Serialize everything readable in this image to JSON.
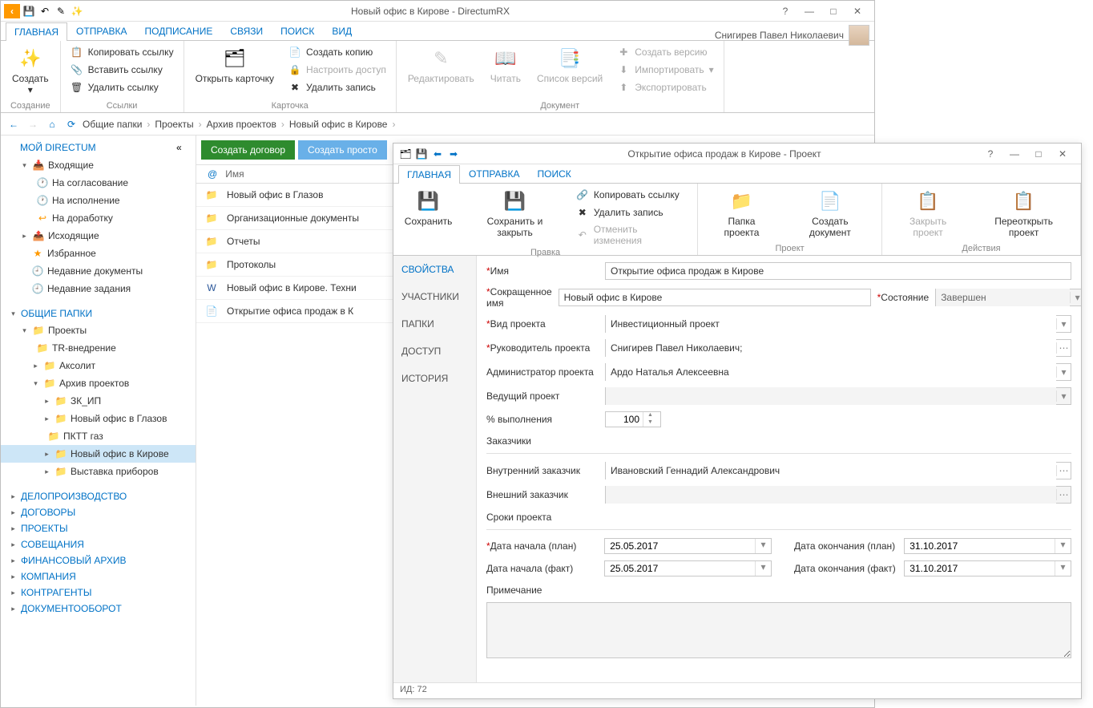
{
  "main": {
    "title": "Новый офис в Кирове - DirectumRX",
    "user": "Снигирев Павел Николаевич",
    "tabs": [
      "ГЛАВНАЯ",
      "ОТПРАВКА",
      "ПОДПИСАНИЕ",
      "СВЯЗИ",
      "ПОИСК",
      "ВИД"
    ],
    "ribbon": {
      "create_group": "Создание",
      "create": "Создать",
      "links_group": "Ссылки",
      "copy_link": "Копировать ссылку",
      "paste_link": "Вставить ссылку",
      "delete_link": "Удалить ссылку",
      "card_group": "Карточка",
      "open_card": "Открыть карточку",
      "create_copy": "Создать копию",
      "set_access": "Настроить доступ",
      "delete_rec": "Удалить запись",
      "doc_group": "Документ",
      "edit": "Редактировать",
      "read": "Читать",
      "versions": "Список версий",
      "create_ver": "Создать версию",
      "import": "Импортировать",
      "export": "Экспортировать"
    },
    "breadcrumb": [
      "Общие папки",
      "Проекты",
      "Архив проектов",
      "Новый офис в Кирове"
    ],
    "nav": {
      "my": "МОЙ DIRECTUM",
      "inbox": "Входящие",
      "approval": "На согласование",
      "exec": "На исполнение",
      "rework": "На доработку",
      "outbox": "Исходящие",
      "favorites": "Избранное",
      "recent_docs": "Недавние документы",
      "recent_tasks": "Недавние задания",
      "folders": "ОБЩИЕ ПАПКИ",
      "projects": "Проекты",
      "tr": "TR-внедрение",
      "aksolit": "Аксолит",
      "archive": "Архив проектов",
      "zk": "ЗК_ИП",
      "glazov": "Новый офис в Глазов",
      "pktt": "ПКТТ газ",
      "kirov": "Новый офис в Кирове",
      "expo": "Выставка приборов",
      "sections": [
        "ДЕЛОПРОИЗВОДСТВО",
        "ДОГОВОРЫ",
        "ПРОЕКТЫ",
        "СОВЕЩАНИЯ",
        "ФИНАНСОВЫЙ АРХИВ",
        "КОМПАНИЯ",
        "КОНТРАГЕНТЫ",
        "ДОКУМЕНТООБОРОТ"
      ]
    },
    "list": {
      "btn1": "Создать договор",
      "btn2": "Создать просто",
      "col_name": "Имя",
      "rows": [
        {
          "ico": "folder",
          "text": "Новый офис в Глазов"
        },
        {
          "ico": "folder",
          "text": "Организационные документы"
        },
        {
          "ico": "folder",
          "text": "Отчеты"
        },
        {
          "ico": "folder",
          "text": "Протоколы"
        },
        {
          "ico": "word",
          "text": "Новый офис в Кирове. Техни"
        },
        {
          "ico": "doc",
          "text": "Открытие офиса продаж в К"
        }
      ]
    }
  },
  "child": {
    "title": "Открытие офиса продаж в Кирове - Проект",
    "tabs": [
      "ГЛАВНАЯ",
      "ОТПРАВКА",
      "ПОИСК"
    ],
    "ribbon": {
      "save": "Сохранить",
      "save_close": "Сохранить и закрыть",
      "edit_group": "Правка",
      "copy_link": "Копировать ссылку",
      "delete_rec": "Удалить запись",
      "undo": "Отменить изменения",
      "project_group": "Проект",
      "project_folder": "Папка проекта",
      "create_doc": "Создать документ",
      "actions_group": "Действия",
      "close_proj": "Закрыть проект",
      "reopen": "Переоткрыть проект"
    },
    "sidebar": [
      "СВОЙСТВА",
      "УЧАСТНИКИ",
      "ПАПКИ",
      "ДОСТУП",
      "ИСТОРИЯ"
    ],
    "form": {
      "name_label": "Имя",
      "name": "Открытие офиса продаж в Кирове",
      "short_label": "Сокращенное имя",
      "short": "Новый офис в Кирове",
      "state_label": "Состояние",
      "state": "Завершен",
      "kind_label": "Вид проекта",
      "kind": "Инвестиционный проект",
      "manager_label": "Руководитель проекта",
      "manager": "Снигирев Павел Николаевич;",
      "admin_label": "Администратор проекта",
      "admin": "Ардо Наталья Алексеевна",
      "lead_label": "Ведущий проект",
      "percent_label": "% выполнения",
      "percent": "100",
      "customers": "Заказчики",
      "int_cust_label": "Внутренний заказчик",
      "int_cust": "Ивановский Геннадий Александрович",
      "ext_cust_label": "Внешний заказчик",
      "dates": "Сроки проекта",
      "start_plan_label": "Дата начала (план)",
      "start_plan": "25.05.2017",
      "end_plan_label": "Дата окончания (план)",
      "end_plan": "31.10.2017",
      "start_fact_label": "Дата начала (факт)",
      "start_fact": "25.05.2017",
      "end_fact_label": "Дата окончания (факт)",
      "end_fact": "31.10.2017",
      "note_label": "Примечание"
    },
    "status": "ИД: 72"
  }
}
